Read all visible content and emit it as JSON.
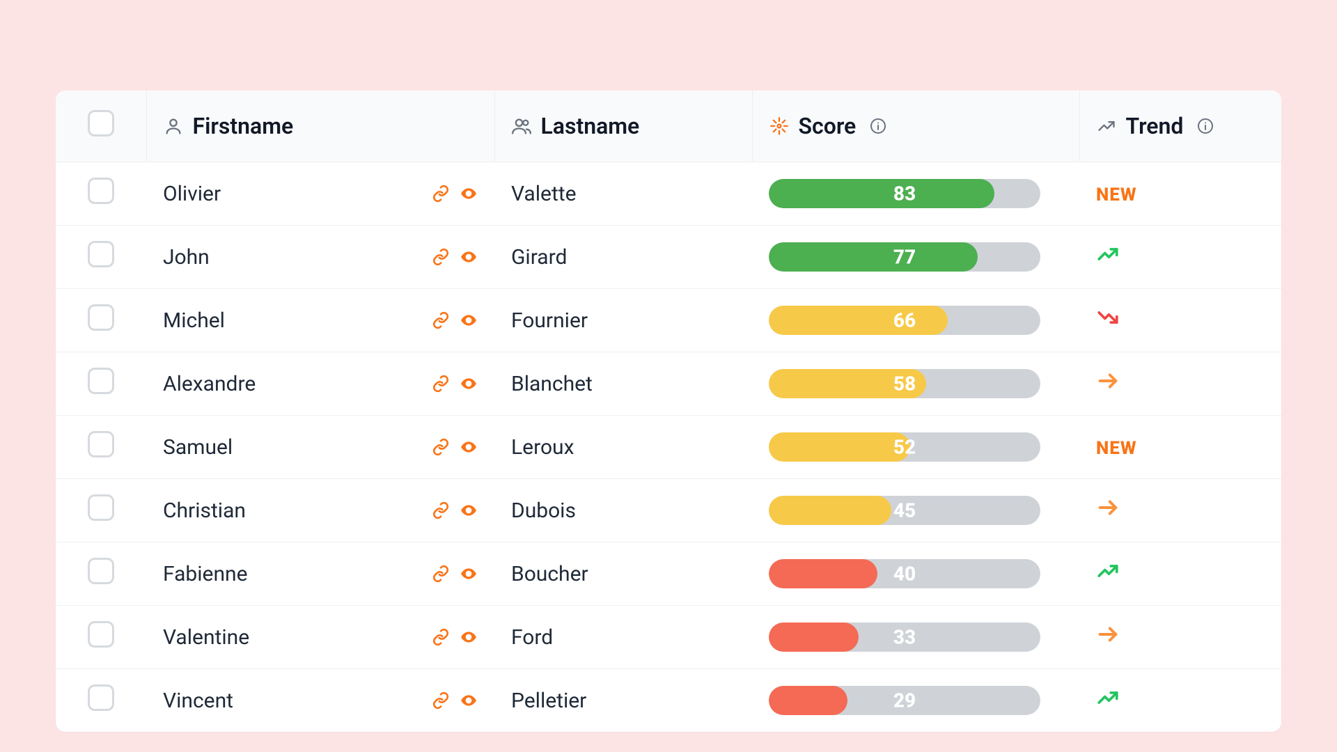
{
  "colors": {
    "accent_orange": "#f97316",
    "green": "#4caf50",
    "yellow": "#f7c948",
    "red": "#f46a55",
    "bar_bg": "#cfd3d8"
  },
  "headers": {
    "firstname": "Firstname",
    "lastname": "Lastname",
    "score": "Score",
    "trend": "Trend"
  },
  "trend_labels": {
    "new": "NEW"
  },
  "rows": [
    {
      "firstname": "Olivier",
      "lastname": "Valette",
      "score": 83,
      "score_color": "green",
      "trend": "new"
    },
    {
      "firstname": "John",
      "lastname": "Girard",
      "score": 77,
      "score_color": "green",
      "trend": "up"
    },
    {
      "firstname": "Michel",
      "lastname": "Fournier",
      "score": 66,
      "score_color": "yellow",
      "trend": "down"
    },
    {
      "firstname": "Alexandre",
      "lastname": "Blanchet",
      "score": 58,
      "score_color": "yellow",
      "trend": "flat"
    },
    {
      "firstname": "Samuel",
      "lastname": "Leroux",
      "score": 52,
      "score_color": "yellow",
      "trend": "new"
    },
    {
      "firstname": "Christian",
      "lastname": "Dubois",
      "score": 45,
      "score_color": "yellow",
      "trend": "flat"
    },
    {
      "firstname": "Fabienne",
      "lastname": "Boucher",
      "score": 40,
      "score_color": "red",
      "trend": "up"
    },
    {
      "firstname": "Valentine",
      "lastname": "Ford",
      "score": 33,
      "score_color": "red",
      "trend": "flat"
    },
    {
      "firstname": "Vincent",
      "lastname": "Pelletier",
      "score": 29,
      "score_color": "red",
      "trend": "up"
    }
  ]
}
